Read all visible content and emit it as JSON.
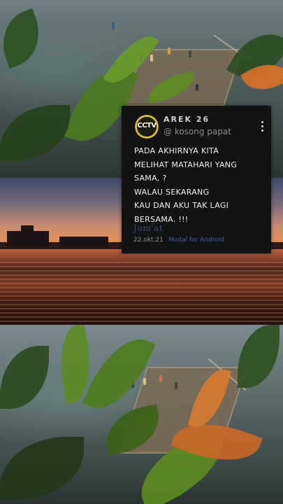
{
  "card": {
    "avatar_text": "CCTV",
    "name": "AREK 26",
    "handle": "@ kosong papat",
    "quote_lines": [
      "PADA AKHIRNYA KITA",
      "MELIHAT MATAHARI YANG",
      "SAMA, ?",
      "WALAU SEKARANG",
      "KAU DAN AKU TAK LAGI",
      "BERSAMA. !!!"
    ],
    "day": "Jum'at",
    "date": "22.okt.21",
    "via": "Modal for Android"
  },
  "colors": {
    "card_bg": "#111214",
    "avatar_ring": "#d9c32c",
    "via_link": "#4d5c9a"
  },
  "icons": [
    "more-vertical-icon"
  ]
}
